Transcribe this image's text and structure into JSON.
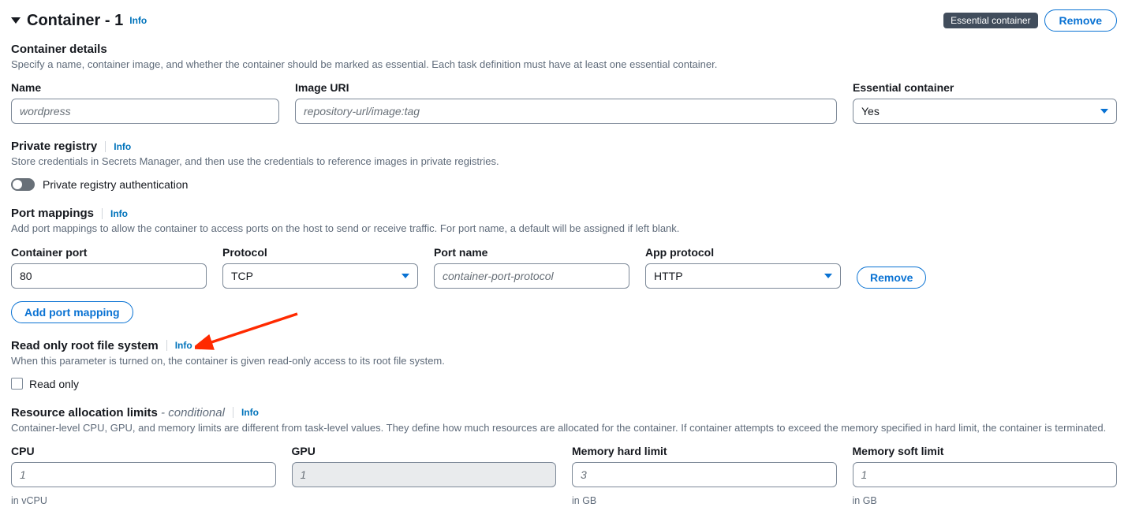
{
  "header": {
    "title": "Container - 1",
    "info": "Info",
    "badge": "Essential container",
    "remove": "Remove"
  },
  "details": {
    "title": "Container details",
    "desc": "Specify a name, container image, and whether the container should be marked as essential. Each task definition must have at least one essential container.",
    "name_label": "Name",
    "name_placeholder": "wordpress",
    "image_label": "Image URI",
    "image_placeholder": "repository-url/image:tag",
    "essential_label": "Essential container",
    "essential_value": "Yes"
  },
  "registry": {
    "title": "Private registry",
    "info": "Info",
    "desc": "Store credentials in Secrets Manager, and then use the credentials to reference images in private registries.",
    "toggle_label": "Private registry authentication"
  },
  "ports": {
    "title": "Port mappings",
    "info": "Info",
    "desc": "Add port mappings to allow the container to access ports on the host to send or receive traffic. For port name, a default will be assigned if left blank.",
    "cols": {
      "container_port": "Container port",
      "protocol": "Protocol",
      "port_name": "Port name",
      "app_protocol": "App protocol"
    },
    "row": {
      "container_port": "80",
      "protocol": "TCP",
      "port_name_placeholder": "container-port-protocol",
      "app_protocol": "HTTP",
      "remove": "Remove"
    },
    "add": "Add port mapping"
  },
  "readonly": {
    "title": "Read only root file system",
    "info": "Info",
    "desc": "When this parameter is turned on, the container is given read-only access to its root file system.",
    "checkbox_label": "Read only"
  },
  "resources": {
    "title": "Resource allocation limits",
    "cond": " - conditional",
    "info": "Info",
    "desc": "Container-level CPU, GPU, and memory limits are different from task-level values. They define how much resources are allocated for the container. If container attempts to exceed the memory specified in hard limit, the container is terminated.",
    "cpu_label": "CPU",
    "cpu_placeholder": "1",
    "cpu_hint": "in vCPU",
    "gpu_label": "GPU",
    "gpu_placeholder": "1",
    "mem_hard_label": "Memory hard limit",
    "mem_hard_placeholder": "3",
    "mem_hard_hint": "in GB",
    "mem_soft_label": "Memory soft limit",
    "mem_soft_placeholder": "1",
    "mem_soft_hint": "in GB"
  }
}
